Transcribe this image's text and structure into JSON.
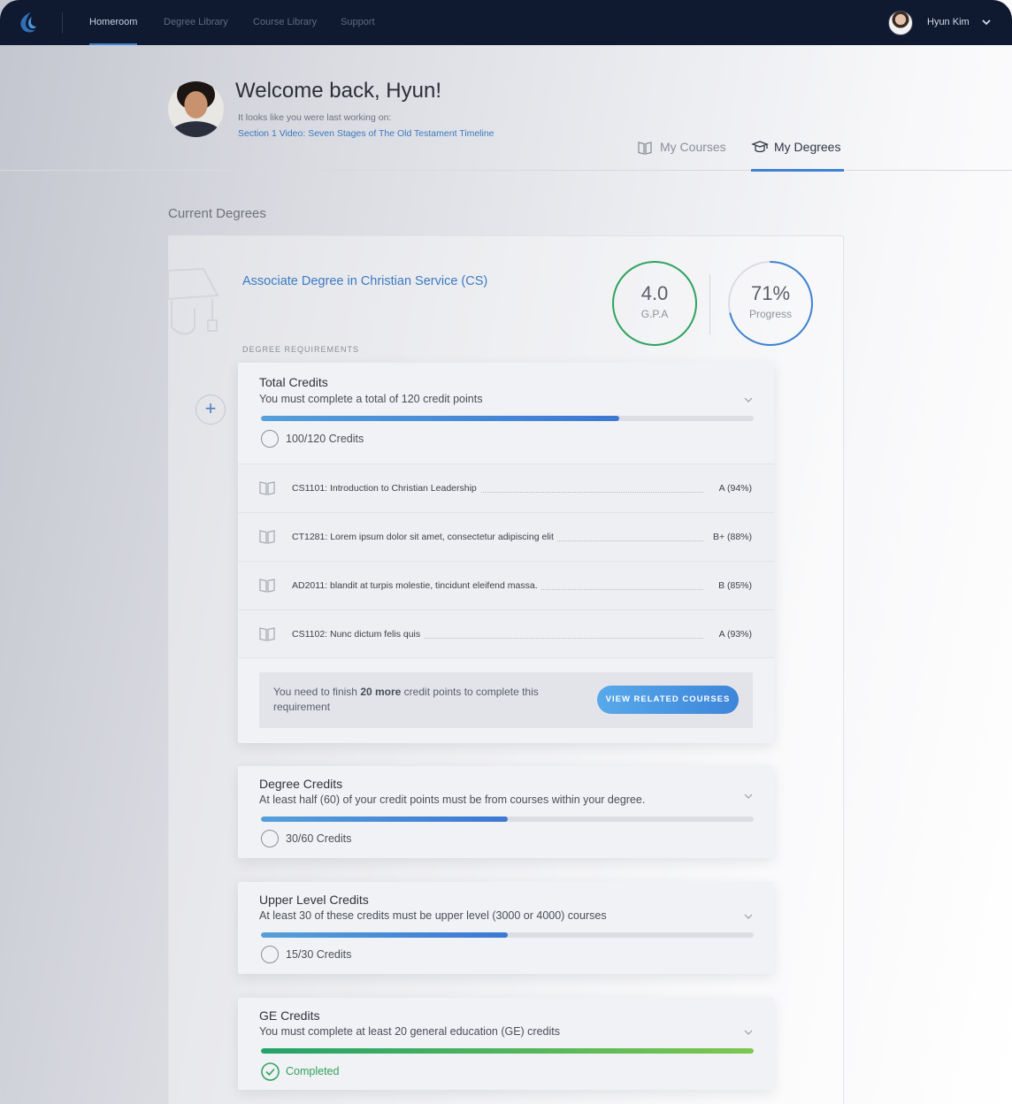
{
  "nav": {
    "links": [
      "Homeroom",
      "Degree Library",
      "Course Library",
      "Support"
    ],
    "active_index": 0,
    "user_name": "Hyun Kim"
  },
  "header": {
    "welcome": "Welcome back, Hyun!",
    "last_working_label": "It looks like you were last working on:",
    "last_working_link": "Section 1 Video:  Seven Stages of The Old Testament Timeline",
    "tabs": [
      {
        "label": "My Courses",
        "icon": "book-icon",
        "active": false
      },
      {
        "label": "My Degrees",
        "icon": "graduation-icon",
        "active": true
      }
    ]
  },
  "main": {
    "section_title": "Current Degrees",
    "degree": {
      "name": "Associate Degree in Christian Service (CS)",
      "requirements_label": "DEGREE REQUIREMENTS",
      "gpa": {
        "value": "4.0",
        "label": "G.P.A",
        "color": "#2ea35f"
      },
      "progress": {
        "value": "71%",
        "label": "Progress",
        "fraction": 0.71,
        "color": "#3f83d2"
      }
    },
    "requirements": [
      {
        "title": "Total Credits",
        "description": "You must complete a total of 120 credit points",
        "progress": 0.727,
        "status": "100/120 Credits",
        "completed": false,
        "courses": [
          {
            "name": "CS1101: Introduction to Christian Leadership",
            "grade": "A (94%)"
          },
          {
            "name": "CT1281: Lorem ipsum dolor sit amet, consectetur adipiscing elit",
            "grade": "B+ (88%)"
          },
          {
            "name": "AD2011: blandit at turpis molestie, tincidunt eleifend massa.",
            "grade": "B (85%)"
          },
          {
            "name": "CS1102: Nunc dictum felis quis",
            "grade": "A (93%)"
          }
        ],
        "cta_prefix": "You need to finish ",
        "cta_bold": "20 more",
        "cta_suffix": " credit points to complete this requirement",
        "cta_button": "VIEW RELATED COURSES"
      },
      {
        "title": "Degree Credits",
        "description": "At least half (60) of your credit points must be from courses within your degree.",
        "progress": 0.5,
        "status": "30/60 Credits",
        "completed": false
      },
      {
        "title": "Upper Level Credits",
        "description": "At least 30 of these credits must be upper level (3000 or 4000) courses",
        "progress": 0.5,
        "status": "15/30 Credits",
        "completed": false
      },
      {
        "title": "GE Credits",
        "description": "You must complete at least 20 general education (GE) credits",
        "progress": 1.0,
        "status": "Completed",
        "completed": true
      }
    ]
  }
}
